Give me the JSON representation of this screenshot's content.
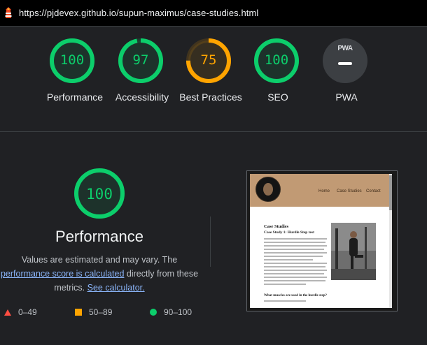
{
  "address_bar": {
    "url": "https://pjdevex.github.io/supun-maximus/case-studies.html"
  },
  "colors": {
    "pass": "#0cce6b",
    "average": "#ffa400",
    "fail": "#ff4e42",
    "neutral": "#e8eaed"
  },
  "gauges": [
    {
      "label": "Performance",
      "score": "100",
      "fraction": 1.0,
      "status": "pass"
    },
    {
      "label": "Accessibility",
      "score": "97",
      "fraction": 0.97,
      "status": "pass"
    },
    {
      "label": "Best Practices",
      "score": "75",
      "fraction": 0.75,
      "status": "average"
    },
    {
      "label": "SEO",
      "score": "100",
      "fraction": 1.0,
      "status": "pass"
    },
    {
      "label": "PWA",
      "score": "PWA",
      "status": "neutral"
    }
  ],
  "summary": {
    "score": "100",
    "fraction": 1.0,
    "title": "Performance",
    "desc_prefix": "Values are estimated and may vary. The ",
    "desc_link": "performance score is calculated",
    "desc_middle": " directly from these metrics. ",
    "calc_link": "See calculator."
  },
  "legend": [
    {
      "range": "0–49",
      "shape": "triangle",
      "color": "#ff4e42"
    },
    {
      "range": "50–89",
      "shape": "square",
      "color": "#ffa400"
    },
    {
      "range": "90–100",
      "shape": "circle",
      "color": "#0cce6b"
    }
  ],
  "screenshot": {
    "nav": [
      "Home",
      "Case Studies",
      "Contact"
    ],
    "heading": "Case Studies",
    "subheading": "Case Study 1: Hurdle Step test",
    "question": "What muscles are used in the hurdle step?"
  }
}
